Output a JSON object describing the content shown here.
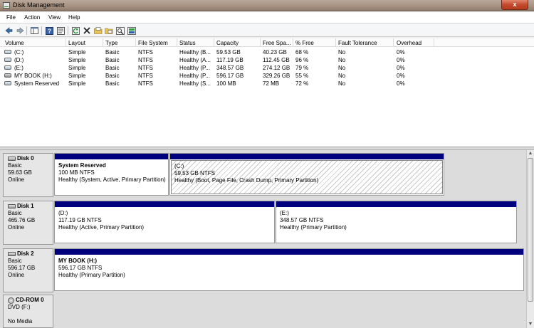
{
  "window": {
    "title": "Disk Management",
    "close_label": "x"
  },
  "menu": [
    "File",
    "Action",
    "View",
    "Help"
  ],
  "toolbar": [
    "back-arrow-icon",
    "forward-arrow-icon",
    "console-tree-icon",
    "help-icon",
    "properties-icon",
    "refresh-icon",
    "delete-icon",
    "open-folder-icon",
    "explore-icon",
    "search-icon",
    "rescan-icon"
  ],
  "volume_table": {
    "columns": [
      "Volume",
      "Layout",
      "Type",
      "File System",
      "Status",
      "Capacity",
      "Free Spa...",
      "% Free",
      "Fault Tolerance",
      "Overhead"
    ],
    "rows": [
      [
        "(C:)",
        "Simple",
        "Basic",
        "NTFS",
        "Healthy (B...",
        "59.53 GB",
        "40.23 GB",
        "68 %",
        "No",
        "0%"
      ],
      [
        "(D:)",
        "Simple",
        "Basic",
        "NTFS",
        "Healthy (A...",
        "117.19 GB",
        "112.45 GB",
        "96 %",
        "No",
        "0%"
      ],
      [
        "(E:)",
        "Simple",
        "Basic",
        "NTFS",
        "Healthy (P...",
        "348.57 GB",
        "274.12 GB",
        "79 %",
        "No",
        "0%"
      ],
      [
        "MY BOOK (H:)",
        "Simple",
        "Basic",
        "NTFS",
        "Healthy (P...",
        "596.17 GB",
        "329.26 GB",
        "55 %",
        "No",
        "0%"
      ],
      [
        "System Reserved",
        "Simple",
        "Basic",
        "NTFS",
        "Healthy (S...",
        "100 MB",
        "72 MB",
        "72 %",
        "No",
        "0%"
      ]
    ]
  },
  "disks": [
    {
      "name": "Disk 0",
      "type": "Basic",
      "size": "59.63 GB",
      "status": "Online",
      "partitions": [
        {
          "name": "System Reserved",
          "size": "100 MB NTFS",
          "status": "Healthy (System, Active, Primary Partition)"
        },
        {
          "name": "(C:)",
          "size": "59.53 GB NTFS",
          "status": "Healthy (Boot, Page File, Crash Dump, Primary Partition)"
        }
      ]
    },
    {
      "name": "Disk 1",
      "type": "Basic",
      "size": "465.76 GB",
      "status": "Online",
      "partitions": [
        {
          "name": "(D:)",
          "size": "117.19 GB NTFS",
          "status": "Healthy (Active, Primary Partition)"
        },
        {
          "name": "(E:)",
          "size": "348.57 GB NTFS",
          "status": "Healthy (Primary Partition)"
        }
      ]
    },
    {
      "name": "Disk 2",
      "type": "Basic",
      "size": "596.17 GB",
      "status": "Online",
      "partitions": [
        {
          "name": "MY BOOK  (H:)",
          "size": "596.17 GB NTFS",
          "status": "Healthy (Primary Partition)"
        }
      ]
    },
    {
      "name": "CD-ROM 0",
      "type": "DVD (F:)",
      "size": "",
      "status": "No Media",
      "partitions": []
    }
  ],
  "colors": {
    "partition_header": "#00007e",
    "title_bar": "#a89383",
    "close_button": "#c54a2c"
  }
}
